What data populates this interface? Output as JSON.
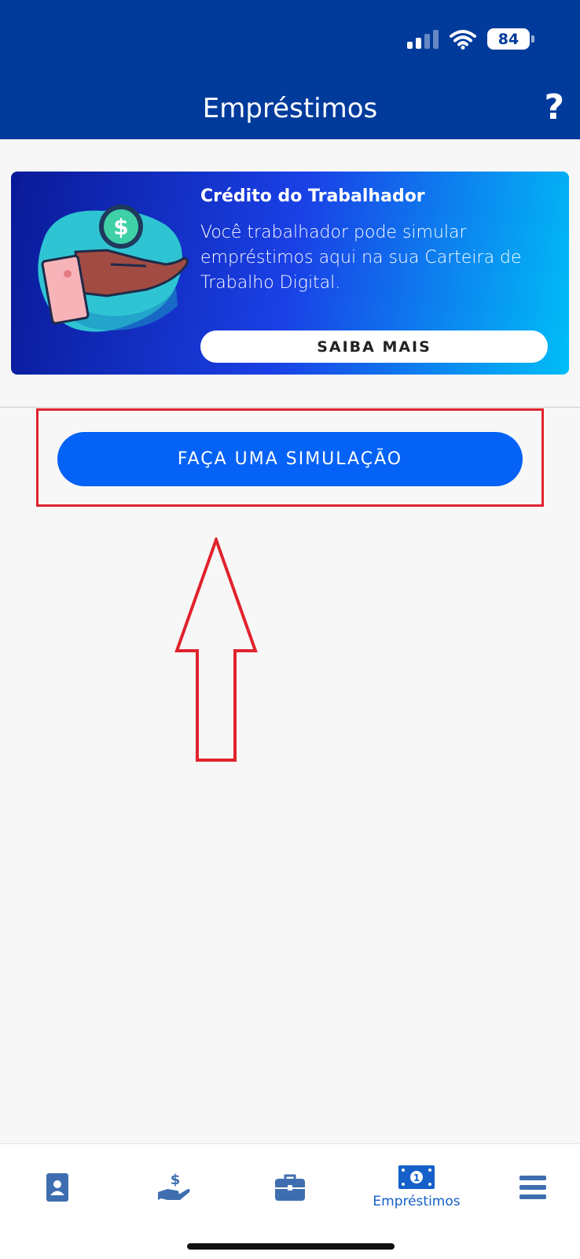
{
  "status_bar": {
    "battery": "84"
  },
  "header": {
    "title": "Empréstimos",
    "help": "?"
  },
  "banner": {
    "title": "Crédito do Trabalhador",
    "text": "Você trabalhador pode simular empréstimos aqui na sua Carteira de Trabalho Digital.",
    "button_label": "SAIBA MAIS",
    "gradient": [
      "#0a1a98",
      "#1a40e6",
      "#00bef7"
    ]
  },
  "main": {
    "simulate_label": "FAÇA UMA SIMULAÇÃO",
    "simulate_color": "#0462f7",
    "annotation_color": "#e0232d"
  },
  "tab_bar": {
    "items": [
      {
        "icon": "id-card-icon",
        "label": ""
      },
      {
        "icon": "hand-money-icon",
        "label": ""
      },
      {
        "icon": "briefcase-icon",
        "label": ""
      },
      {
        "icon": "banknote-icon",
        "label": "Empréstimos",
        "active": true
      },
      {
        "icon": "menu-icon",
        "label": ""
      }
    ],
    "active_color": "#1560c9",
    "icon_color": "#3f6eb0"
  },
  "colors": {
    "header_bg": "#003b9c",
    "page_bg": "#f7f7f7"
  }
}
